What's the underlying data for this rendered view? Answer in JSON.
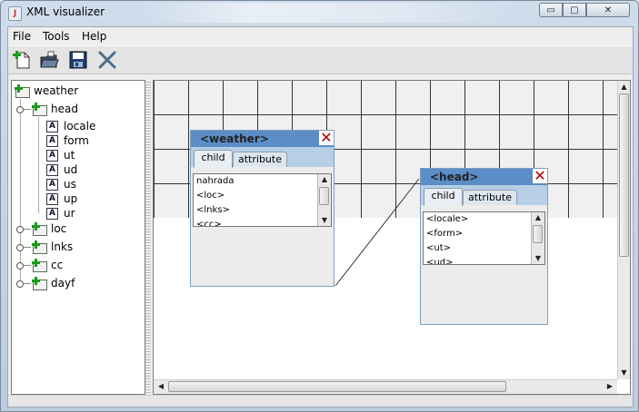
{
  "window": {
    "title": "XML visualizer",
    "controls": {
      "minimize": "▭",
      "maximize": "▢",
      "close": "✕"
    }
  },
  "menu": [
    "File",
    "Tools",
    "Help"
  ],
  "toolbar": [
    {
      "name": "new-document-icon"
    },
    {
      "name": "open-folder-icon"
    },
    {
      "name": "save-icon"
    },
    {
      "name": "delete-x-icon"
    }
  ],
  "tree": {
    "root": "weather",
    "head": {
      "label": "head",
      "attributes": [
        "locale",
        "form",
        "ut",
        "ud",
        "us",
        "up",
        "ur"
      ],
      "attr_icon": "A"
    },
    "siblings": [
      "loc",
      "lnks",
      "cc",
      "dayf"
    ]
  },
  "nodes": {
    "weather": {
      "title": "<weather>",
      "tabs": [
        "child",
        "attribute"
      ],
      "items": [
        "nahrada",
        "<loc>",
        "<lnks>",
        "<cc>"
      ]
    },
    "head": {
      "title": "<head>",
      "tabs": [
        "child",
        "attribute"
      ],
      "items": [
        "<locale>",
        "<form>",
        "<ut>",
        "<ud>"
      ]
    }
  },
  "colors": {
    "node_header": "#5b8dc7",
    "tab_strip": "#b7cfe6",
    "close_x": "#b00000",
    "plus_green": "#1a9a1a"
  }
}
